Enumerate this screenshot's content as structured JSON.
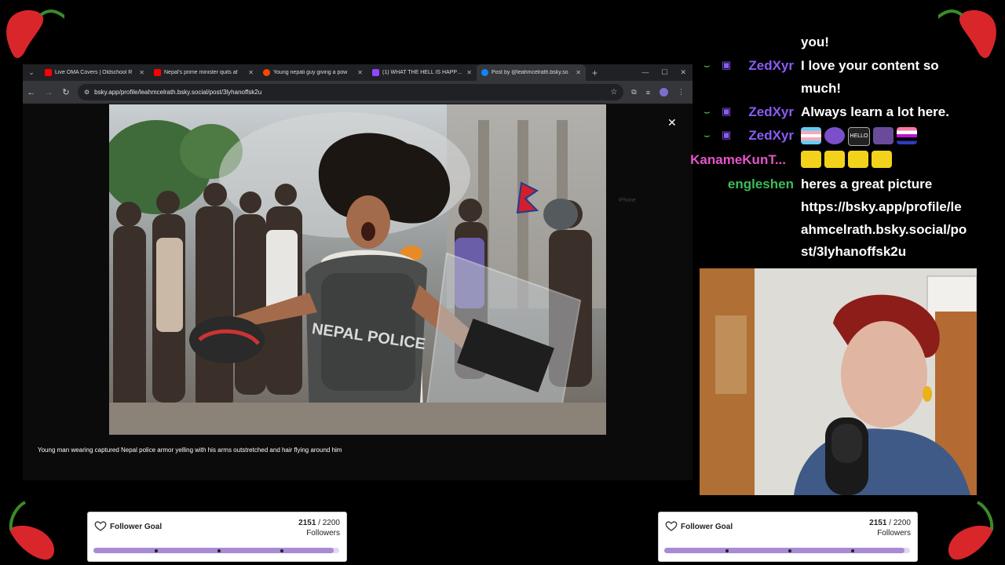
{
  "browser": {
    "tabs": [
      {
        "label": "Live OMA Covers | Oldschool R",
        "favicon": "youtube-icon",
        "color": "#ff0000"
      },
      {
        "label": "Nepal's prime minister quits af",
        "favicon": "youtube-icon",
        "color": "#ff0000"
      },
      {
        "label": "Young nepali guy giving a pow",
        "favicon": "reddit-icon",
        "color": "#ff4500"
      },
      {
        "label": "(1) WHAT THE HELL IS HAPPEN",
        "favicon": "twitch-icon",
        "color": "#9146ff"
      },
      {
        "label": "Post by @leahmcelrath.bsky.so",
        "favicon": "bluesky-icon",
        "color": "#1185fe",
        "active": true
      }
    ],
    "url": "bsky.app/profile/leahmcelrath.bsky.social/post/3lyhanoffsk2u",
    "viewer": {
      "close_label": "✕",
      "side_label": "iPhone",
      "caption": "Young man wearing captured Nepal police armor yelling with his arms outstretched and hair flying around him",
      "photo_text": "NEPAL POLICE"
    }
  },
  "chat": {
    "messages": [
      {
        "user": "",
        "text": "you!"
      },
      {
        "user": "ZedXyr",
        "user_color": "#8a5cf6",
        "text": "I love your content so much!"
      },
      {
        "user": "ZedXyr",
        "user_color": "#8a5cf6",
        "text": "Always learn a lot here."
      },
      {
        "user": "ZedXyr",
        "user_color": "#8a5cf6",
        "text": "",
        "emotes": [
          "trans-flag-emote",
          "purple-cat-emote",
          "hello-emote",
          "bag-emote",
          "genderfluid-flag-emote"
        ]
      },
      {
        "user": "KanameKunT...",
        "user_color": "#e455c8",
        "text": "",
        "emotes": [
          "yellow-glyph-emote",
          "yellow-glyph-emote",
          "yellow-glyph-emote",
          "yellow-glyph-emote"
        ]
      },
      {
        "user": "engleshen",
        "user_color": "#3dbb5a",
        "text": "heres a great picture"
      },
      {
        "user": "",
        "text": "https://bsky.app/profile/le"
      },
      {
        "user": "",
        "text": "ahmcelrath.bsky.social/po"
      },
      {
        "user": "",
        "text": "st/3lyhanoffsk2u"
      }
    ]
  },
  "goals": [
    {
      "title": "Follower Goal",
      "current": "2151",
      "target": "/ 2200",
      "unit": "Followers",
      "progress": 0.978
    },
    {
      "title": "Follower Goal",
      "current": "2151",
      "target": "/ 2200",
      "unit": "Followers",
      "progress": 0.978
    }
  ],
  "colors": {
    "goal_fill": "#a78bd6",
    "goal_track": "#e2d6f3",
    "chili": "#d9262b"
  }
}
